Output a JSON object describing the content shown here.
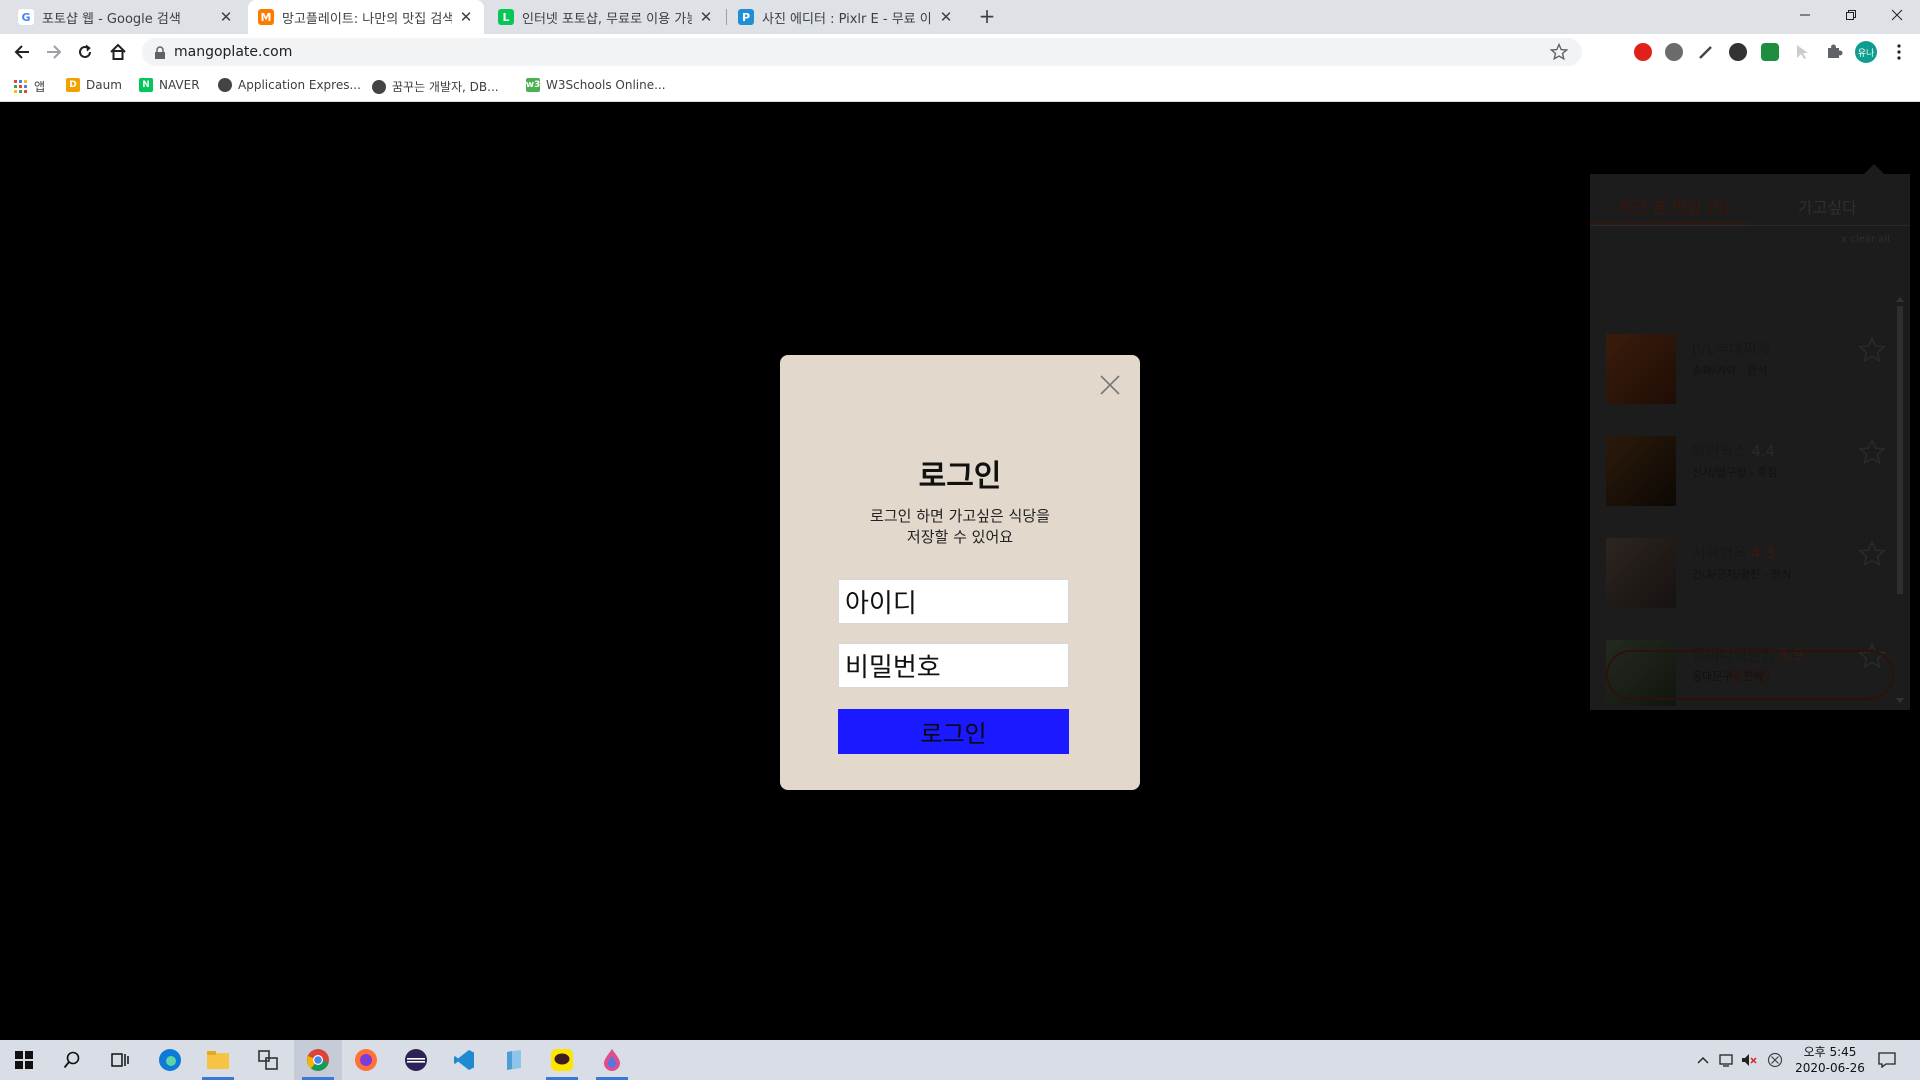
{
  "browser": {
    "tabs": [
      {
        "title": "포토샵 웹 - Google 검색",
        "icon": "google-g-icon"
      },
      {
        "title": "망고플레이트: 나만의 맛집 검색",
        "icon": "mangoplate-icon"
      },
      {
        "title": "인터넷 포토샵, 무료로 이용 가능",
        "icon": "line-app-icon"
      },
      {
        "title": "사진 에디터 : Pixlr E - 무료 이미",
        "icon": "pixlr-icon"
      }
    ],
    "new_tab_label": "+",
    "url": "mangoplate.com",
    "bookmarks": [
      {
        "label": "앱",
        "icon": "apps-grid-icon"
      },
      {
        "label": "Daum",
        "icon": "daum-icon"
      },
      {
        "label": "NAVER",
        "icon": "naver-icon"
      },
      {
        "label": "Application Expres...",
        "icon": "globe-icon"
      },
      {
        "label": "꿈꾸는 개발자, DB...",
        "icon": "globe-icon"
      },
      {
        "label": "W3Schools Online...",
        "icon": "w3schools-icon"
      }
    ],
    "profile_initials": "유나",
    "window_controls": [
      "minimize-icon",
      "maximize-icon",
      "close-icon"
    ]
  },
  "recent_panel": {
    "tab_recent": "최근 본 맛집 (5)",
    "tab_wish": "가고싶다",
    "clear_all": "x clear all",
    "items": [
      {
        "name": "JVL부대찌개",
        "score": "",
        "category": "송파/가락 - 한식"
      },
      {
        "name": "와인웍스",
        "score": "4.4",
        "category": "신사/압구정 - 주점"
      },
      {
        "name": "서북면옥",
        "score": "4.3",
        "category": "건대/군자/광진 - 한식"
      },
      {
        "name": "할머니냉면집",
        "score": "3.9",
        "category": "동대문구 - 한식"
      }
    ],
    "login_button": "로그인"
  },
  "modal": {
    "title": "로그인",
    "desc_line1": "로그인 하면 가고싶은 식당을",
    "desc_line2": "저장할 수 있어요",
    "id_field": "아이디",
    "password_field": "비밀번호",
    "submit": "로그인"
  },
  "taskbar": {
    "icons": [
      "windows-start-icon",
      "search-icon",
      "task-view-icon",
      "edge-icon",
      "file-explorer-icon",
      "windows-app-icon",
      "chrome-icon",
      "firefox-icon",
      "eclipse-icon",
      "vscode-icon",
      "notepad-icon",
      "kakaotalk-icon",
      "paint-icon"
    ],
    "time": "오후 5:45",
    "date": "2020-06-26"
  }
}
